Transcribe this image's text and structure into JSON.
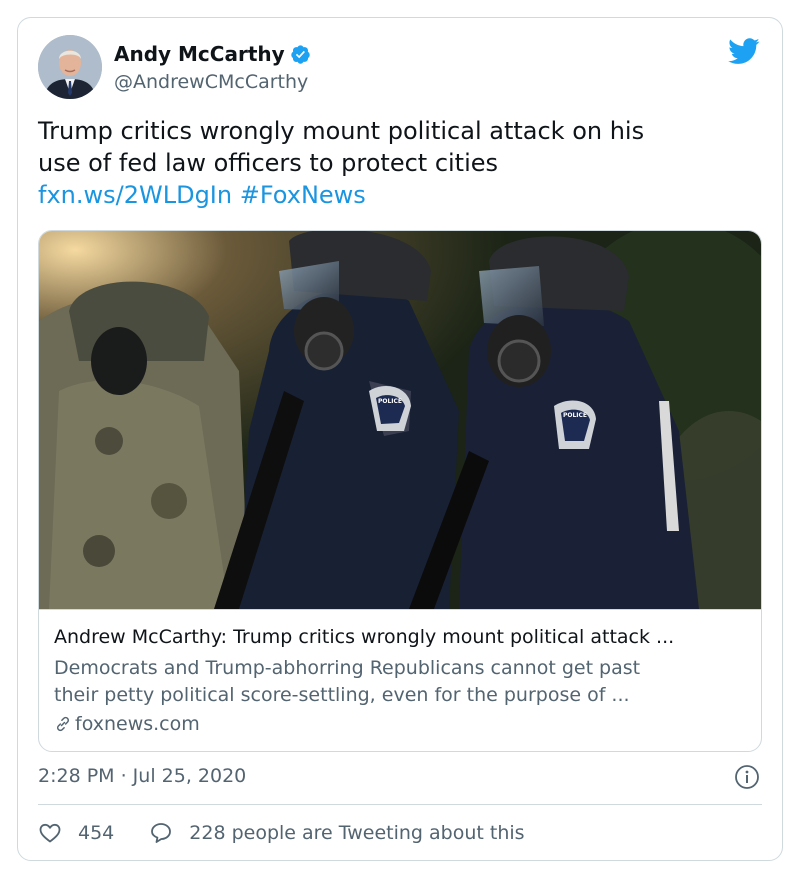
{
  "author": {
    "name": "Andy McCarthy",
    "handle": "@AndrewCMcCarthy",
    "verified": true
  },
  "tweet": {
    "text_line1": "Trump critics wrongly mount political attack on his",
    "text_line2": "use of fed law officers to protect cities",
    "link": "fxn.ws/2WLDgIn",
    "hashtag": "#FoxNews"
  },
  "card": {
    "title": "Andrew McCarthy: Trump critics wrongly mount political attack ...",
    "description_line1": "Democrats and Trump-abhorring Republicans cannot get past",
    "description_line2": "their petty political score-settling, even for the purpose of ...",
    "domain": "foxnews.com",
    "badge_text": "POLICE"
  },
  "meta": {
    "timestamp": "2:28 PM · Jul 25, 2020"
  },
  "actions": {
    "likes": "454",
    "tweeting": "228 people are Tweeting about this"
  },
  "icons": {
    "brand": "twitter-bird-icon",
    "verified": "verified-badge-icon",
    "info": "info-icon",
    "like": "heart-icon",
    "reply": "speech-bubble-icon",
    "link": "link-icon"
  },
  "colors": {
    "accent": "#1b95e0",
    "text": "#0f1419",
    "secondary": "#536471",
    "border": "#cfd9de"
  }
}
